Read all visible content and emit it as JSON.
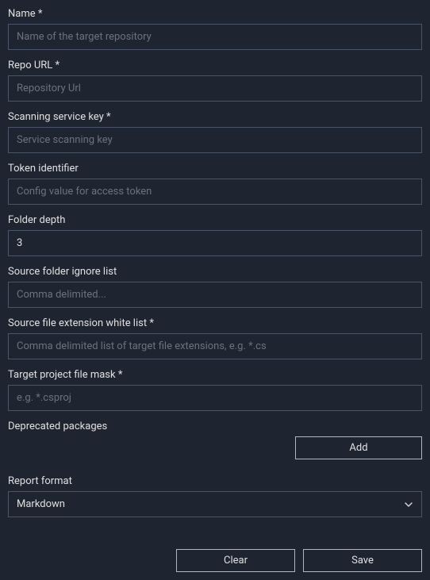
{
  "fields": {
    "name": {
      "label": "Name *",
      "placeholder": "Name of the target repository",
      "value": ""
    },
    "repo_url": {
      "label": "Repo URL *",
      "placeholder": "Repository Url",
      "value": ""
    },
    "scanning_service_key": {
      "label": "Scanning service key *",
      "placeholder": "Service scanning key",
      "value": ""
    },
    "token_identifier": {
      "label": "Token identifier",
      "placeholder": "Config value for access token",
      "value": ""
    },
    "folder_depth": {
      "label": "Folder depth",
      "value": "3"
    },
    "source_folder_ignore": {
      "label": "Source folder ignore list",
      "placeholder": "Comma delimited...",
      "value": ""
    },
    "source_file_ext_whitelist": {
      "label": "Source file extension white list *",
      "placeholder": "Comma delimited list of target file extensions, e.g. *.cs",
      "value": ""
    },
    "target_project_mask": {
      "label": "Target project file mask *",
      "placeholder": "e.g. *.csproj",
      "value": ""
    },
    "deprecated_packages": {
      "label": "Deprecated packages"
    },
    "report_format": {
      "label": "Report format",
      "selected": "Markdown"
    }
  },
  "buttons": {
    "add": "Add",
    "clear": "Clear",
    "save": "Save"
  }
}
